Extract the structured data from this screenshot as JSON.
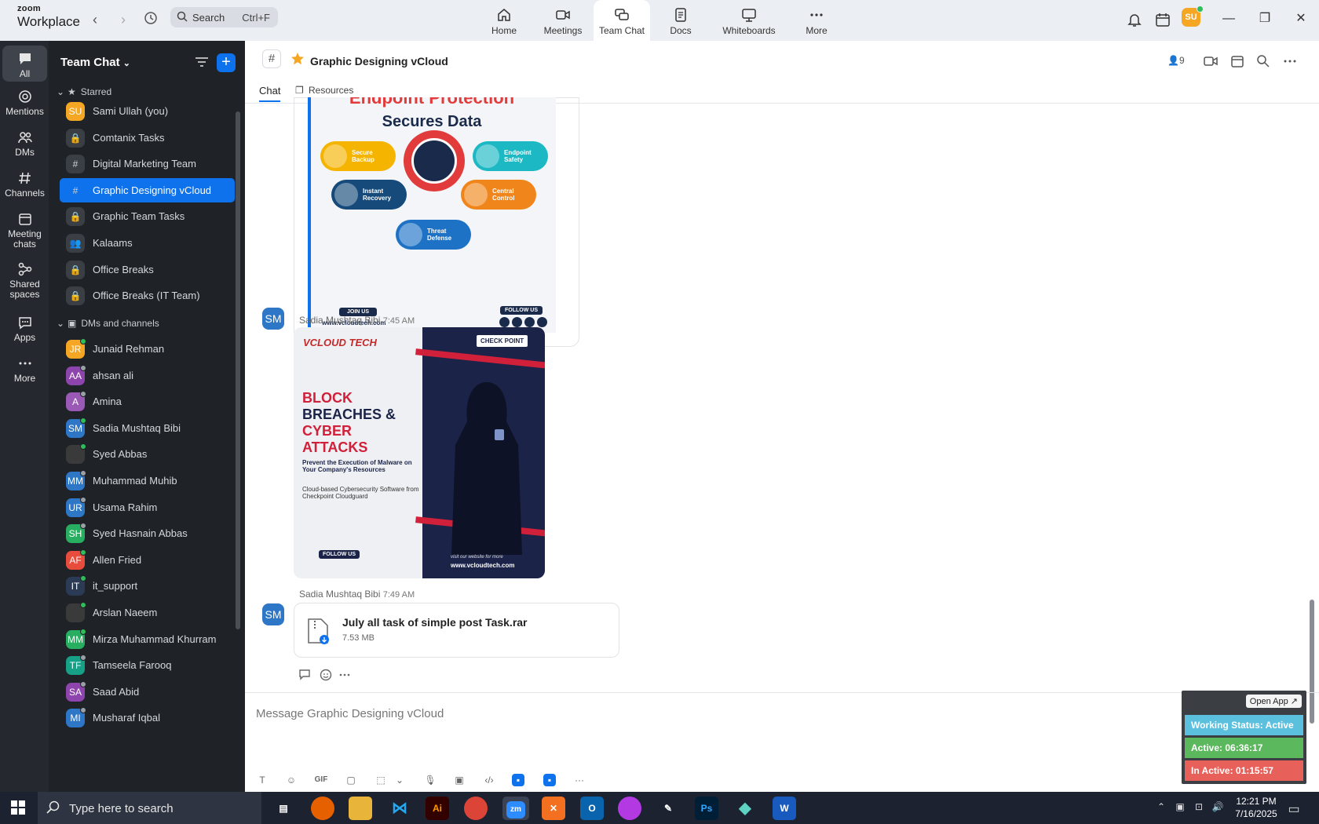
{
  "app": {
    "brand_top": "zoom",
    "brand_bottom": "Workplace"
  },
  "search": {
    "label": "Search",
    "shortcut": "Ctrl+F"
  },
  "tabs": [
    {
      "label": "Home",
      "icon": "home-icon"
    },
    {
      "label": "Meetings",
      "icon": "video-camera-icon"
    },
    {
      "label": "Team Chat",
      "icon": "chat-bubbles-icon"
    },
    {
      "label": "Docs",
      "icon": "document-icon"
    },
    {
      "label": "Whiteboards",
      "icon": "whiteboard-icon"
    },
    {
      "label": "More",
      "icon": "more-dots-icon"
    }
  ],
  "user": {
    "initials": "SU",
    "avatar_color": "#f5a623"
  },
  "rail": [
    {
      "label": "All",
      "icon": "chat-icon"
    },
    {
      "label": "Mentions",
      "icon": "at-icon"
    },
    {
      "label": "DMs",
      "icon": "people-icon"
    },
    {
      "label": "Channels",
      "icon": "hash-icon"
    },
    {
      "label": "Meeting chats",
      "icon": "calendar-icon"
    },
    {
      "label": "Shared spaces",
      "icon": "share-icon"
    },
    {
      "label": "Apps",
      "icon": "apps-icon"
    },
    {
      "label": "More",
      "icon": "more-icon"
    }
  ],
  "sidebar": {
    "title": "Team Chat",
    "starred_label": "Starred",
    "dms_label": "DMs and channels",
    "starred": [
      {
        "label": "Sami Ullah (you)",
        "initials": "SU",
        "color": "#f5a623",
        "type": "user"
      },
      {
        "label": "Comtanix Tasks",
        "type": "lock"
      },
      {
        "label": "Digital Marketing Team",
        "type": "hash"
      },
      {
        "label": "Graphic Designing vCloud",
        "type": "hash",
        "active": true
      },
      {
        "label": "Graphic Team Tasks",
        "type": "lock"
      },
      {
        "label": "Kalaams",
        "type": "group"
      },
      {
        "label": "Office Breaks",
        "type": "lock"
      },
      {
        "label": "Office Breaks (IT Team)",
        "type": "lock"
      }
    ],
    "dms": [
      {
        "label": "Junaid Rehman",
        "initials": "JR",
        "color": "#f5a623",
        "presence": "#2ebd59"
      },
      {
        "label": "ahsan ali",
        "initials": "AA",
        "color": "#8e44ad",
        "presence": "#9aa0a6"
      },
      {
        "label": "Amina",
        "initials": "A",
        "color": "#9b59b6",
        "presence": "#9aa0a6"
      },
      {
        "label": "Sadia Mushtaq Bibi",
        "initials": "SM",
        "color": "#2d77c6",
        "presence": "#2ebd59"
      },
      {
        "label": "Syed Abbas",
        "initials": "",
        "color": "#3a3a3a",
        "presence": "#2ebd59"
      },
      {
        "label": "Muhammad Muhib",
        "initials": "MM",
        "color": "#2d77c6",
        "presence": "#9aa0a6"
      },
      {
        "label": "Usama Rahim",
        "initials": "UR",
        "color": "#2d77c6",
        "presence": "#9aa0a6"
      },
      {
        "label": "Syed Hasnain Abbas",
        "initials": "SH",
        "color": "#27ae60",
        "presence": "#9aa0a6"
      },
      {
        "label": "Allen Fried",
        "initials": "AF",
        "color": "#e74c3c",
        "presence": "#2ebd59"
      },
      {
        "label": "it_support",
        "initials": "IT",
        "color": "#2b3a55",
        "presence": "#2ebd59"
      },
      {
        "label": "Arslan Naeem",
        "initials": "",
        "color": "#3a3a3a",
        "presence": "#2ebd59"
      },
      {
        "label": "Mirza Muhammad Khurram",
        "initials": "MM",
        "color": "#27ae60",
        "presence": "#2ebd59"
      },
      {
        "label": "Tamseela Farooq",
        "initials": "TF",
        "color": "#16a085",
        "presence": "#9aa0a6"
      },
      {
        "label": "Saad Abid",
        "initials": "SA",
        "color": "#8e44ad",
        "presence": "#9aa0a6"
      },
      {
        "label": "Musharaf Iqbal",
        "initials": "MI",
        "color": "#2d77c6",
        "presence": "#9aa0a6"
      }
    ]
  },
  "channel": {
    "name": "Graphic Designing vCloud",
    "member_count": "9",
    "tab_chat": "Chat",
    "tab_resources": "Resources"
  },
  "poster1": {
    "title_top": "Endpoint Protection",
    "title": "Secures Data",
    "pills": [
      "Secure Backup",
      "Endpoint Safety",
      "Instant Recovery",
      "Central Control",
      "Threat Defense"
    ],
    "join": "JOIN US",
    "url": "www.vcloudtech.com",
    "follow": "FOLLOW US"
  },
  "messages": [
    {
      "sender": "Sadia Mushtaq Bibi",
      "time": "7:45 AM",
      "initials": "SM"
    },
    {
      "sender": "Sadia Mushtaq Bibi",
      "time": "7:49 AM",
      "initials": "SM"
    }
  ],
  "poster2": {
    "brand": "VCLOUD TECH",
    "partner": "CHECK POINT",
    "headline_1": "BLOCK",
    "headline_2": "BREACHES &",
    "headline_3": "CYBER",
    "headline_4": "ATTACKS",
    "sub": "Prevent the Execution of Malware on Your Company's Resources",
    "desc": "Cloud-based Cybersecurity Software from Checkpoint Cloudguard",
    "follow": "FOLLOW US",
    "visit": "visit our website for more",
    "url": "www.vcloudtech.com"
  },
  "file": {
    "name": "July all task of simple post Task.rar",
    "size": "7.53 MB"
  },
  "composer": {
    "placeholder": "Message Graphic Designing vCloud",
    "gif": "GIF"
  },
  "status_widget": {
    "open_app": "Open App ↗",
    "working_status": "Working Status: Active",
    "active": "Active: 06:36:17",
    "inactive": "In Active: 01:15:57",
    "colors": {
      "status": "#5bc0de",
      "active": "#5cb85c",
      "inactive": "#e8605a"
    }
  },
  "taskbar": {
    "search_placeholder": "Type here to search",
    "time": "12:21 PM",
    "date": "7/16/2025"
  }
}
